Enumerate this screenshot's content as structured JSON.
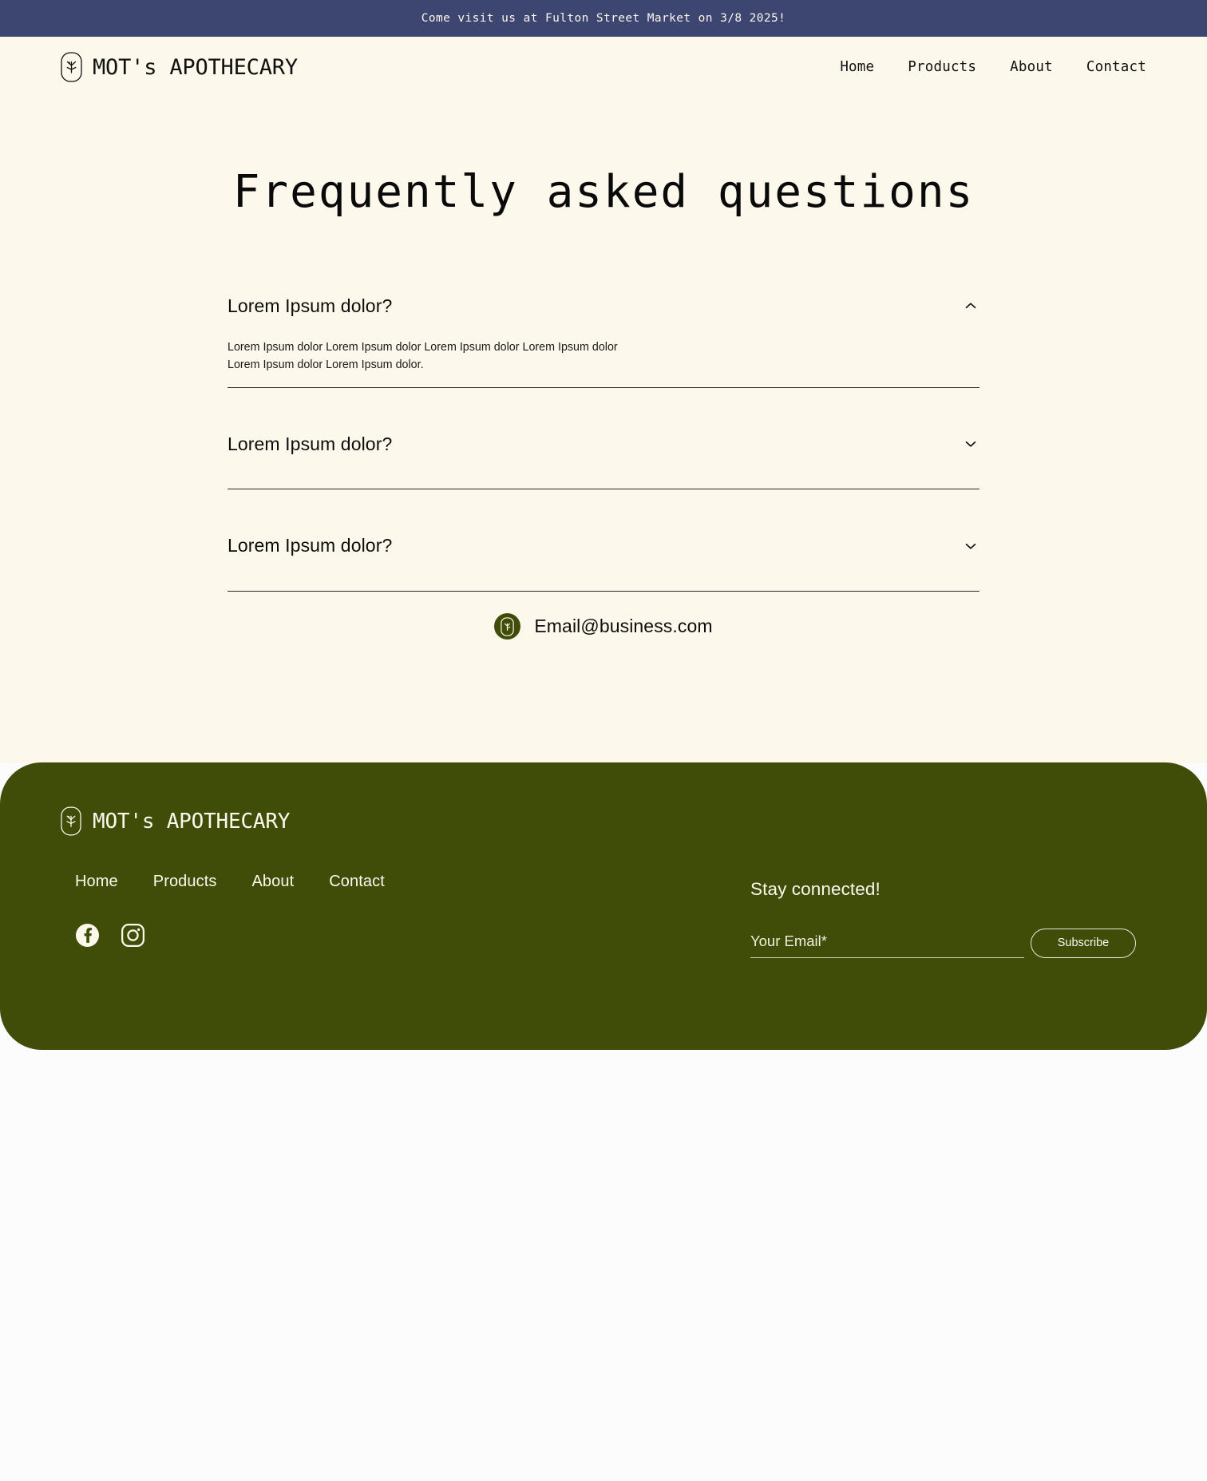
{
  "announcement": {
    "text": "Come visit us at Fulton Street Market on 3/8 2025!",
    "bg_color": "#3D4571"
  },
  "theme": {
    "page_bg": "#FDF8EC",
    "footer_green": "#3F4D09",
    "text_dark": "#0D0D0D",
    "text_cream": "#FDF8EC"
  },
  "header": {
    "brand_name": "MOT's APOTHECARY",
    "logo_icon": "sprig-in-capsule-icon",
    "nav": [
      {
        "label": "Home"
      },
      {
        "label": "Products"
      },
      {
        "label": "About"
      },
      {
        "label": "Contact"
      }
    ]
  },
  "faq": {
    "title": "Frequently asked questions",
    "items": [
      {
        "question": "Lorem Ipsum dolor?",
        "answer": "Lorem Ipsum dolor Lorem Ipsum dolor Lorem Ipsum dolor Lorem Ipsum dolor Lorem Ipsum dolor Lorem Ipsum dolor.",
        "expanded": true,
        "chevron": "chevron-up-icon"
      },
      {
        "question": "Lorem Ipsum dolor?",
        "answer": "",
        "expanded": false,
        "chevron": "chevron-down-icon"
      },
      {
        "question": "Lorem Ipsum dolor?",
        "answer": "",
        "expanded": false,
        "chevron": "chevron-down-icon"
      }
    ]
  },
  "contact": {
    "email": "Email@business.com",
    "badge_icon": "sprig-in-capsule-icon",
    "badge_color": "#3F4D09"
  },
  "footer": {
    "brand_name": "MOT's APOTHECARY",
    "logo_icon": "sprig-in-capsule-icon",
    "nav": [
      {
        "label": "Home"
      },
      {
        "label": "Products"
      },
      {
        "label": "About"
      },
      {
        "label": "Contact"
      }
    ],
    "social": [
      {
        "name": "facebook-icon"
      },
      {
        "name": "instagram-icon"
      }
    ],
    "newsletter": {
      "title": "Stay connected!",
      "email_placeholder": "Your Email*",
      "email_value": "",
      "subscribe_label": "Subscribe"
    }
  }
}
